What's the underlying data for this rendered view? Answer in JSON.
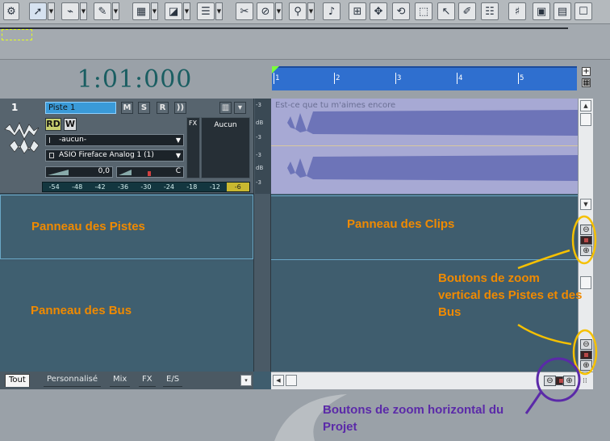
{
  "toolbar": {
    "buttons": [
      "select-tool",
      "draw-tool",
      "envelope-tool",
      "pencil-tool",
      "grid-snap",
      "crop-tool",
      "marker-list",
      "scissors-tool",
      "mute-tool",
      "zoom-tool",
      "audio-scrub",
      "insert-track",
      "move-tool",
      "loop-tool",
      "select-arrow",
      "pencil-alt",
      "clip-props",
      "keyboard",
      "region",
      "meter",
      "console"
    ]
  },
  "time_display": "1:01:000",
  "ruler": {
    "ticks": [
      "1",
      "2",
      "3",
      "4",
      "5"
    ]
  },
  "track": {
    "number": "1",
    "name": "Piste 1",
    "buttons": {
      "mute": "M",
      "solo": "S",
      "record": "R",
      "monitor": "))"
    },
    "rd": "RD",
    "w": "W",
    "input": "-aucun-",
    "output": "ASIO Fireface Analog 1 (1)",
    "volume_value": "0,0",
    "pan_value": "C",
    "fx_label": "FX",
    "fx_slot": "Aucun",
    "meter_ticks": [
      "-54",
      "-48",
      "-42",
      "-36",
      "-30",
      "-24",
      "-18",
      "-12",
      "-6"
    ],
    "db_labels": [
      "-3",
      "dB",
      "-3",
      "-3",
      "dB",
      "-3"
    ]
  },
  "clip": {
    "title": "Est-ce que tu m'aimes encore"
  },
  "labels": {
    "tracks_pane": "Panneau des Pistes",
    "clips_pane": "Panneau des Clips",
    "bus_pane": "Panneau des Bus",
    "vertical_zoom": "Boutons de zoom vertical des Pistes et des Bus",
    "horizontal_zoom": "Boutons de zoom horizontal du Projet"
  },
  "tabs": [
    "Tout",
    "Personnalisé",
    "Mix",
    "FX",
    "E/S"
  ],
  "colors": {
    "annotation_orange": "#f08a00",
    "annotation_purple": "#5b2aa8",
    "ruler_blue": "#2f6fcf",
    "clip_bg": "#a7a9d4",
    "waveform": "#6d74b8"
  }
}
